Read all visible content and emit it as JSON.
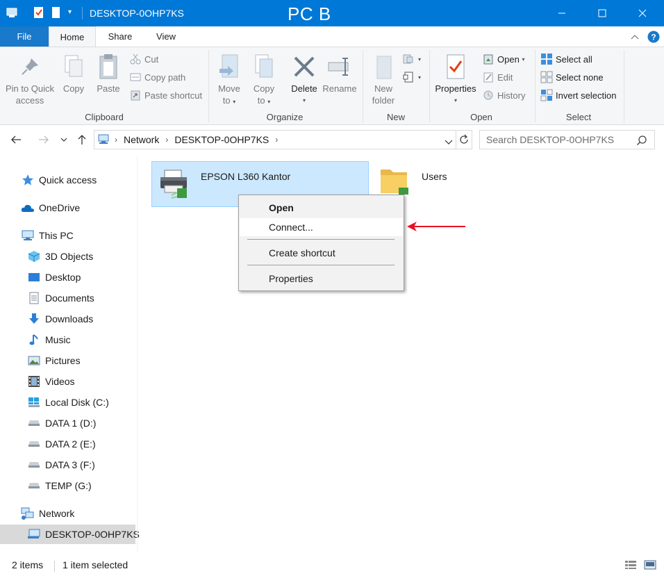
{
  "window": {
    "title": "DESKTOP-0OHP7KS",
    "overlay_label": "PC B"
  },
  "ribbon_tabs": {
    "file": "File",
    "home": "Home",
    "share": "Share",
    "view": "View"
  },
  "ribbon": {
    "clipboard": {
      "group_label": "Clipboard",
      "pin_line1": "Pin to Quick",
      "pin_line2": "access",
      "copy": "Copy",
      "paste": "Paste",
      "cut": "Cut",
      "copy_path": "Copy path",
      "paste_shortcut": "Paste shortcut"
    },
    "organize": {
      "group_label": "Organize",
      "move_line1": "Move",
      "move_line2": "to",
      "copy_line1": "Copy",
      "copy_line2": "to",
      "delete": "Delete",
      "rename": "Rename"
    },
    "new": {
      "group_label": "New",
      "new_line1": "New",
      "new_line2": "folder"
    },
    "open": {
      "group_label": "Open",
      "properties": "Properties",
      "open": "Open",
      "edit": "Edit",
      "history": "History"
    },
    "select": {
      "group_label": "Select",
      "select_all": "Select all",
      "select_none": "Select none",
      "invert": "Invert selection"
    }
  },
  "address": {
    "crumbs": [
      "Network",
      "DESKTOP-0OHP7KS"
    ],
    "search_placeholder": "Search DESKTOP-0OHP7KS"
  },
  "nav_pane": {
    "quick_access": "Quick access",
    "onedrive": "OneDrive",
    "this_pc": "This PC",
    "objects3d": "3D Objects",
    "desktop": "Desktop",
    "documents": "Documents",
    "downloads": "Downloads",
    "music": "Music",
    "pictures": "Pictures",
    "videos": "Videos",
    "local_disk": "Local Disk (C:)",
    "data1": "DATA 1 (D:)",
    "data2": "DATA 2 (E:)",
    "data3": "DATA 3 (F:)",
    "temp": "TEMP (G:)",
    "network": "Network",
    "desktop_host": "DESKTOP-0OHP7KS"
  },
  "content": {
    "printer_name": "EPSON L360 Kantor",
    "users_folder": "Users"
  },
  "context_menu": {
    "open": "Open",
    "connect": "Connect...",
    "create_shortcut": "Create shortcut",
    "properties": "Properties"
  },
  "status": {
    "items": "2 items",
    "selected": "1 item selected"
  },
  "colors": {
    "titlebar": "#0078d7",
    "file_tab": "#1979ca",
    "selection": "#cce8ff",
    "annotation_arrow": "#e81123"
  }
}
